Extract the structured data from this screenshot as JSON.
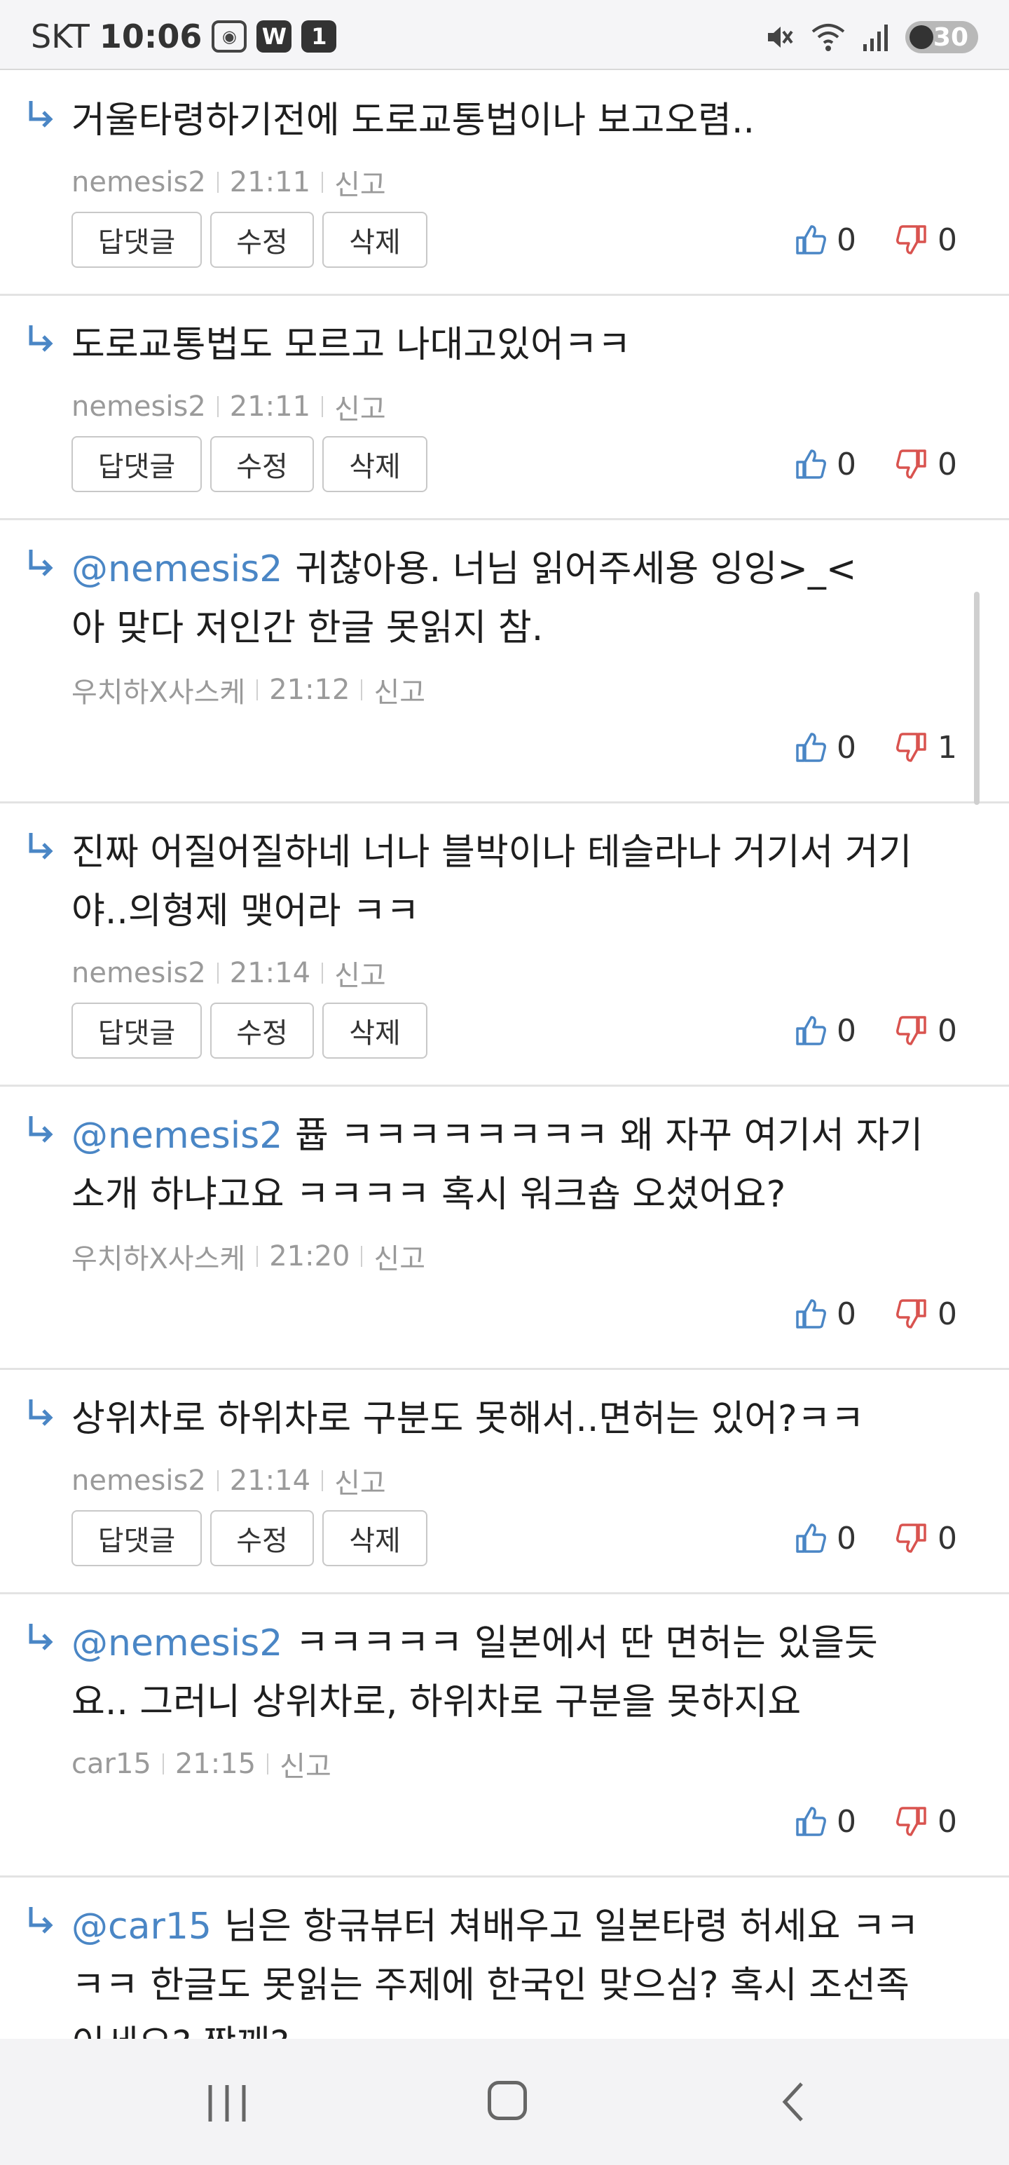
{
  "status_bar": {
    "carrier": "SKT",
    "time": "10:06",
    "app_icon_1": "W",
    "app_icon_2": "1",
    "battery": "30"
  },
  "comments": [
    {
      "mention": "",
      "lines": [
        "거울타령하기전에 도로교통법이나 보고오렴.."
      ],
      "author": "nemesis2",
      "time": "21:11",
      "report": "신고",
      "buttons": {
        "reply": "답댓글",
        "edit": "수정",
        "delete": "삭제"
      },
      "likes": "0",
      "dislikes": "0"
    },
    {
      "mention": "",
      "lines": [
        "도로교통법도 모르고 나대고있어ㅋㅋ"
      ],
      "author": "nemesis2",
      "time": "21:11",
      "report": "신고",
      "buttons": {
        "reply": "답댓글",
        "edit": "수정",
        "delete": "삭제"
      },
      "likes": "0",
      "dislikes": "0"
    },
    {
      "mention": "@nemesis2",
      "lines": [
        "귀찮아용. 너님 읽어주세용 잉잉>_<",
        "아 맞다 저인간 한글 못읽지 참."
      ],
      "author": "우치하X사스케",
      "time": "21:12",
      "report": "신고",
      "likes": "0",
      "dislikes": "1"
    },
    {
      "mention": "",
      "lines": [
        "진짜 어질어질하네 너나 블박이나 테슬라나 거기서 거기",
        "야..의형제 맺어라 ㅋㅋ"
      ],
      "author": "nemesis2",
      "time": "21:14",
      "report": "신고",
      "buttons": {
        "reply": "답댓글",
        "edit": "수정",
        "delete": "삭제"
      },
      "likes": "0",
      "dislikes": "0"
    },
    {
      "mention": "@nemesis2",
      "lines": [
        "퓹 ㅋㅋㅋㅋㅋㅋㅋㅋ 왜 자꾸 여기서 자기",
        "소개 하냐고요 ㅋㅋㅋㅋ 혹시 워크숍 오셨어요?"
      ],
      "author": "우치하X사스케",
      "time": "21:20",
      "report": "신고",
      "likes": "0",
      "dislikes": "0"
    },
    {
      "mention": "",
      "lines": [
        "상위차로 하위차로 구분도 못해서..면허는 있어?ㅋㅋ"
      ],
      "author": "nemesis2",
      "time": "21:14",
      "report": "신고",
      "buttons": {
        "reply": "답댓글",
        "edit": "수정",
        "delete": "삭제"
      },
      "likes": "0",
      "dislikes": "0"
    },
    {
      "mention": "@nemesis2",
      "lines": [
        "ㅋㅋㅋㅋㅋ 일본에서 딴 면허는 있을듯",
        "요.. 그러니 상위차로, 하위차로 구분을 못하지요"
      ],
      "author": "car15",
      "time": "21:15",
      "report": "신고",
      "likes": "0",
      "dislikes": "0"
    },
    {
      "mention": "@car15",
      "lines": [
        "님은 항귺뷰터 쳐배우고 일본타령 허세요 ㅋㅋ",
        "ㅋㅋ 한글도 못읽는 주제에 한국인 맞으심? 혹시 조선족",
        "이세요? 짱깨?"
      ]
    }
  ]
}
